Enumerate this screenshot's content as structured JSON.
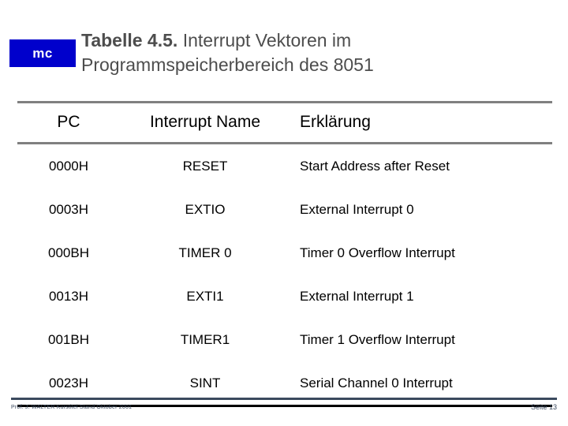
{
  "slide": {
    "logo_label": "mc",
    "logo_color": "#0000CC",
    "title_strong": "Tabelle 4.5.",
    "title_rest": " Interrupt Vektoren im Programmspeicherbereich des 8051"
  },
  "table": {
    "columns": [
      "PC",
      "Interrupt Name",
      "Erklärung"
    ],
    "rows": [
      {
        "pc": "0000H",
        "name": "RESET",
        "desc": "Start Address after Reset"
      },
      {
        "pc": "0003H",
        "name": "EXTIO",
        "desc": "External Interrupt 0"
      },
      {
        "pc": "000BH",
        "name": "TIMER 0",
        "desc": "Timer 0 Overflow Interrupt"
      },
      {
        "pc": "0013H",
        "name": "EXTI1",
        "desc": "External Interrupt 1"
      },
      {
        "pc": "001BH",
        "name": "TIMER1",
        "desc": "Timer 1 Overflow Interrupt"
      },
      {
        "pc": "0023H",
        "name": "SINT",
        "desc": "Serial Channel 0 Interrupt"
      }
    ]
  },
  "footer": {
    "left": "Prof. J. WALTER  Kurstitel  Stand Oktober 2001",
    "right": "Seite 13",
    "rule_color": "#3b4a5e"
  }
}
